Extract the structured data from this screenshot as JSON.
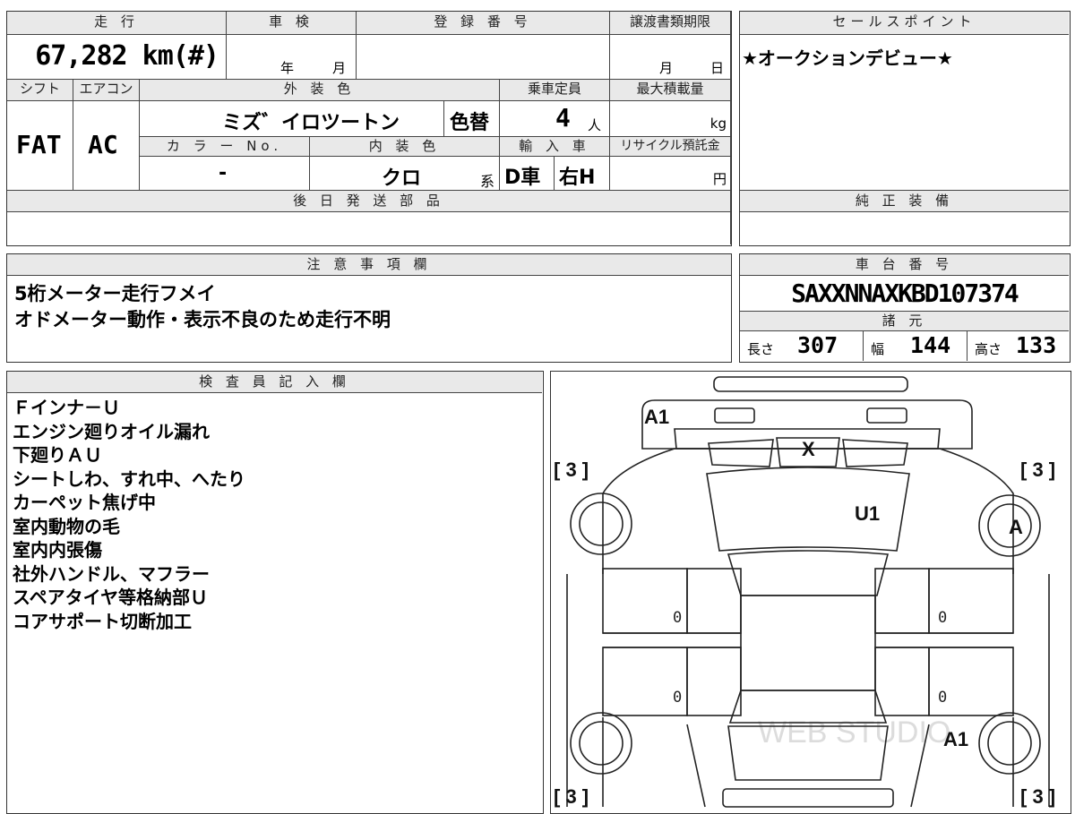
{
  "top_table": {
    "mileage_header": "走 行",
    "mileage_value": "67,282 km(#)",
    "shaken_header": "車 検",
    "shaken_year": "年",
    "shaken_month": "月",
    "reg_header": "登 録 番 号",
    "transfer_header": "譲渡書類期限",
    "transfer_month": "月",
    "transfer_day": "日",
    "shift_header": "シフト",
    "ac_header": "エアコン",
    "exterior_header": "外 装 色",
    "capacity_header": "乗車定員",
    "maxload_header": "最大積載量",
    "shift_value": "FAT",
    "ac_value": "AC",
    "exterior_value": "ミズ゛イロツートン",
    "color_change": "色替",
    "capacity_value": "4",
    "capacity_unit": "人",
    "maxload_unit": "kg",
    "color_no_header": "カ ラ ー No.",
    "interior_header": "内 装 色",
    "import_header": "輸 入 車",
    "recycle_header": "リサイクル預託金",
    "color_no_value": "-",
    "interior_value": "クロ",
    "interior_suffix": "系",
    "import_type": "D車",
    "steering": "右H",
    "recycle_unit": "円",
    "later_parts_header": "後 日 発 送 部 品"
  },
  "sales_point": {
    "header": "セールスポイント",
    "text": "★オークションデビュー★",
    "equipment_header": "純 正 装 備"
  },
  "notes": {
    "header": "注 意 事 項 欄",
    "lines": [
      "5桁メーター走行フメイ",
      "オドメーター動作・表示不良のため走行不明"
    ]
  },
  "chassis": {
    "header": "車 台 番 号",
    "number": "SAXXNNAXKBD107374",
    "specs_header": "諸 元",
    "length_label": "長さ",
    "length_value": "307",
    "width_label": "幅",
    "width_value": "144",
    "height_label": "高さ",
    "height_value": "133"
  },
  "inspector": {
    "header": "検 査 員 記 入 欄",
    "lines": [
      "Ｆインナ－Ｕ",
      "エンジン廻りオイル漏れ",
      "下廻りＡＵ",
      "シートしわ、すれ中、へたり",
      "カーペット焦げ中",
      "室内動物の毛",
      "室内内張傷",
      "社外ハンドル、マフラー",
      "スペアタイヤ等格納部Ｕ",
      "コアサポート切断加工"
    ]
  },
  "diagram": {
    "marks": {
      "front_bumper": "A1",
      "hood": "X",
      "windshield": "U1",
      "front_right_wheel": "A",
      "rear_right_wheel": "A1",
      "front_left_tire": "[ 3 ]",
      "front_right_tire": "[ 3 ]",
      "rear_left_tire": "[ 3 ]",
      "rear_right_tire": "[ 3 ]",
      "left_front_door": "0",
      "left_rear_door": "0",
      "right_front_door": "0",
      "right_rear_door": "0"
    },
    "watermark": "WEB STUDIO"
  }
}
